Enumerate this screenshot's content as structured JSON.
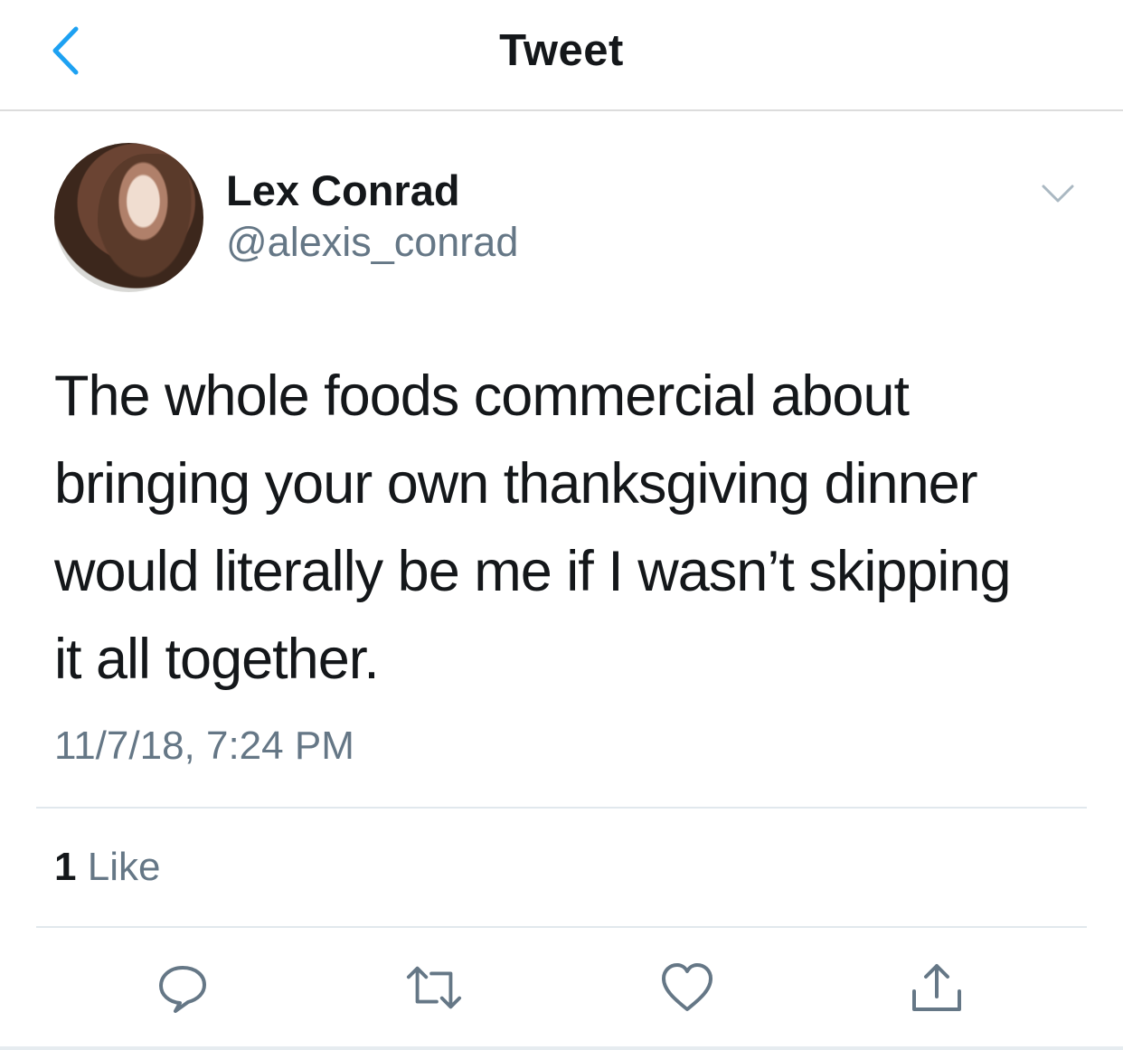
{
  "nav": {
    "title": "Tweet",
    "back_icon": "chevron-left-icon"
  },
  "colors": {
    "accent": "#1da1f2",
    "text": "#14171a",
    "secondary": "#657786",
    "icon": "#657786"
  },
  "author": {
    "name": "Lex Conrad",
    "handle": "@alexis_conrad",
    "avatar": "profile-photo"
  },
  "tweet": {
    "lines": [
      "The whole foods commercial about",
      "bringing your own thanksgiving dinner",
      "would literally be me if I wasn’t skipping",
      "it all together."
    ],
    "timestamp": "11/7/18, 7:24 PM"
  },
  "stats": {
    "likes_count": "1",
    "likes_label": "Like"
  },
  "actions": [
    {
      "name": "reply",
      "icon": "reply-icon"
    },
    {
      "name": "retweet",
      "icon": "retweet-icon"
    },
    {
      "name": "like",
      "icon": "heart-icon"
    },
    {
      "name": "share",
      "icon": "share-icon"
    }
  ]
}
